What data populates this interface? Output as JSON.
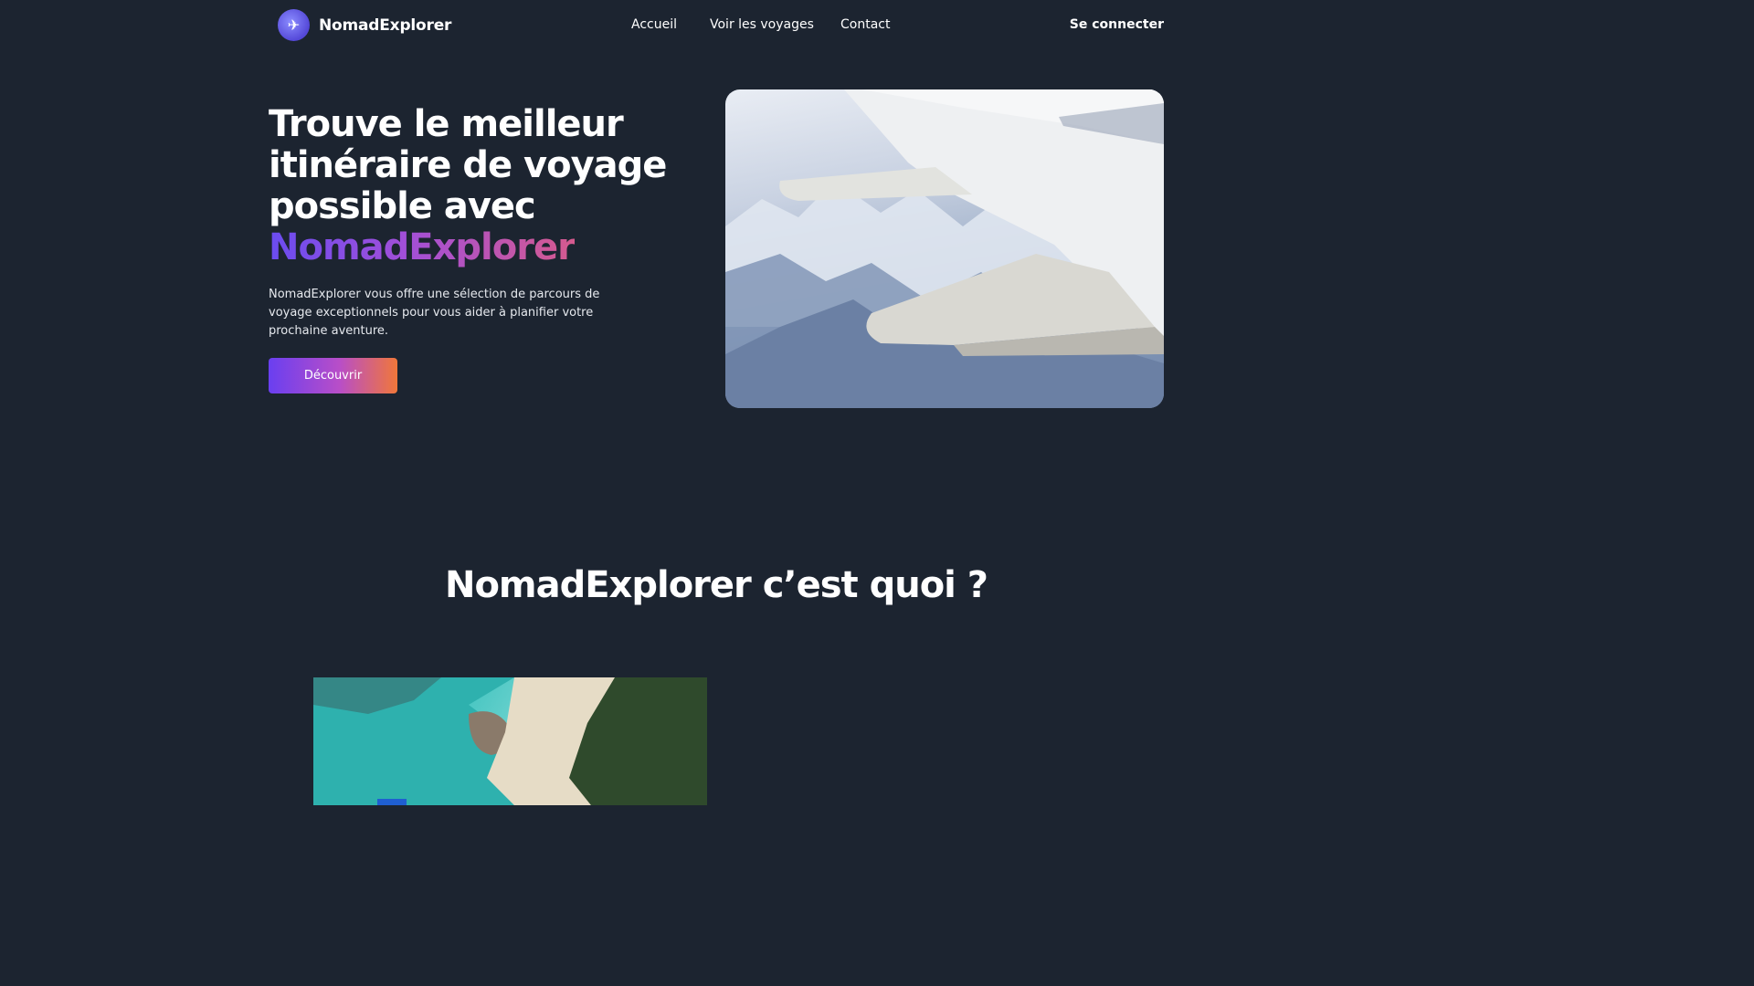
{
  "header": {
    "brand": "NomadExplorer",
    "brand_icon": "globe-plane-icon",
    "nav": [
      {
        "label": "Accueil"
      },
      {
        "label": "Voir les voyages"
      },
      {
        "label": "Contact"
      }
    ],
    "login_label": "Se connecter"
  },
  "hero": {
    "title_lines": [
      "Trouve le meilleur",
      "itinéraire de voyage",
      "possible avec"
    ],
    "title_brand": "NomadExplorer",
    "description": "NomadExplorer vous offre une sélection de parcours de voyage exceptionnels pour vous aider à planifier votre prochaine aventure.",
    "cta_label": "Découvrir",
    "image": "airplane-wing-photo"
  },
  "about": {
    "title": "NomadExplorer c’est quoi ?",
    "image": "beach-aerial-photo"
  },
  "colors": {
    "background": "#1c2430",
    "accent_start": "#6a3ff0",
    "accent_end": "#f0773a"
  }
}
